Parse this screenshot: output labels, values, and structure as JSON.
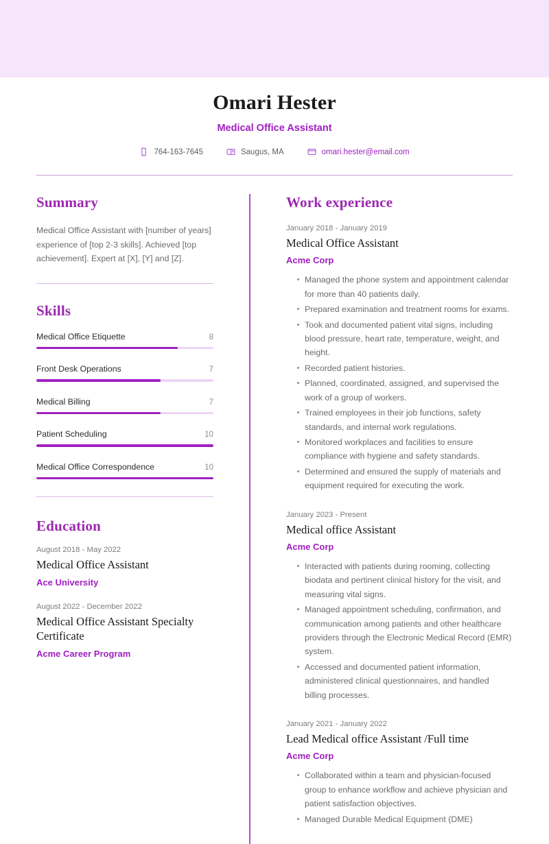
{
  "theme": {
    "banner_color": "#f5e6fb",
    "accent_color": "#a020c0",
    "heading_color": "#9c27b0",
    "body_text_color": "#6b6b6b"
  },
  "header": {
    "name": "Omari Hester",
    "title": "Medical Office Assistant",
    "contacts": [
      {
        "icon": "phone-icon",
        "value": "764-163-7645"
      },
      {
        "icon": "location-icon",
        "value": "Saugus, MA"
      },
      {
        "icon": "email-icon",
        "value": "omari.hester@email.com"
      }
    ]
  },
  "summary": {
    "heading": "Summary",
    "text": "Medical Office Assistant with [number of years] experience of [top 2-3 skills]. Achieved [top achievement]. Expert at [X], [Y] and [Z]."
  },
  "skills": {
    "heading": "Skills",
    "max_score": 10,
    "items": [
      {
        "name": "Medical Office Etiquette",
        "score": "8",
        "percent": 80
      },
      {
        "name": "Front Desk Operations",
        "score": "7",
        "percent": 70
      },
      {
        "name": "Medical Billing",
        "score": "7",
        "percent": 70
      },
      {
        "name": "Patient Scheduling",
        "score": "10",
        "percent": 100
      },
      {
        "name": "Medical Office Correspondence",
        "score": "10",
        "percent": 100
      }
    ]
  },
  "education": {
    "heading": "Education",
    "items": [
      {
        "date": "August 2018 - May 2022",
        "title": "Medical Office Assistant",
        "org": "Ace University"
      },
      {
        "date": "August 2022 - December 2022",
        "title": "Medical Office Assistant Specialty Certificate",
        "org": "Acme Career Program"
      }
    ]
  },
  "work_experience": {
    "heading": "Work experience",
    "items": [
      {
        "date": "January 2018 - January 2019",
        "title": "Medical Office Assistant",
        "org": "Acme Corp",
        "bullets": [
          "Managed the phone system and appointment calendar for more than 40 patients daily.",
          "Prepared examination and treatment rooms for exams.",
          "Took and documented patient vital signs, including blood pressure, heart rate, temperature, weight, and height.",
          "Recorded patient histories.",
          "Planned, coordinated, assigned, and supervised the work of a group of workers.",
          "Trained employees in their job functions, safety standards, and internal work regulations.",
          "Monitored workplaces and facilities to ensure compliance with hygiene and safety standards.",
          "Determined and ensured the supply of materials and equipment required for executing the work."
        ]
      },
      {
        "date": "January 2023 - Present",
        "title": "Medical office Assistant",
        "org": "Acme Corp",
        "bullets": [
          "Interacted with patients during rooming, collecting biodata and pertinent clinical history for the visit, and measuring vital signs.",
          "Managed appointment scheduling, confirmation, and communication among patients and other healthcare providers through the Electronic Medical Record (EMR) system.",
          "Accessed and documented patient information, administered clinical questionnaires, and handled billing processes."
        ]
      },
      {
        "date": "January 2021 - January 2022",
        "title": "Lead Medical office Assistant /Full time",
        "org": "Acme Corp",
        "bullets": [
          "Collaborated within a team and physician-focused group to enhance workflow and achieve physician and patient satisfaction objectives.",
          "Managed Durable Medical Equipment (DME)"
        ]
      }
    ]
  }
}
